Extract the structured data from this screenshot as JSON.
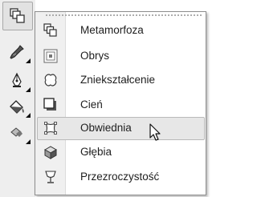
{
  "toolbar": {
    "tools": [
      {
        "name": "effects-tool",
        "icon": "effects-tool-icon",
        "active": true
      },
      {
        "name": "eyedropper-tool",
        "icon": "eyedropper-icon",
        "active": false
      },
      {
        "name": "outline-pen-tool",
        "icon": "pen-nib-icon",
        "active": false
      },
      {
        "name": "fill-tool",
        "icon": "paint-bucket-icon",
        "active": false
      },
      {
        "name": "smart-fill-tool",
        "icon": "smart-fill-icon",
        "active": false
      }
    ]
  },
  "menu": {
    "items": [
      {
        "label": "Metamorfoza",
        "icon": "blend-icon"
      },
      {
        "label": "Obrys",
        "icon": "contour-icon"
      },
      {
        "label": "Zniekształcenie",
        "icon": "distort-icon"
      },
      {
        "label": "Cień",
        "icon": "shadow-icon"
      },
      {
        "label": "Obwiednia",
        "icon": "envelope-icon",
        "hovered": true
      },
      {
        "label": "Głębia",
        "icon": "extrude-icon"
      },
      {
        "label": "Przezroczystość",
        "icon": "transparency-icon"
      }
    ]
  },
  "colors": {
    "toolbar_bg": "#eeeeee",
    "menu_gutter": "#f0f0f0",
    "hover_bg": "#e7e7e7",
    "text": "#1e1e1e"
  }
}
